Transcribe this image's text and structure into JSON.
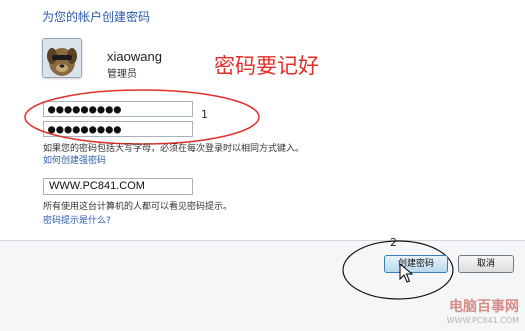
{
  "dialog": {
    "title": "为您的帐户创建密码"
  },
  "user": {
    "name": "xiaowang",
    "role": "管理员",
    "avatar_icon": "dog-avatar-icon"
  },
  "annotation": {
    "note": "密码要记好",
    "marker_1": "1",
    "marker_2": "2",
    "color": "#e0302a"
  },
  "form": {
    "password_value": "●●●●●●●●●",
    "confirm_value": "●●●●●●●●●",
    "case_warning": "如果您的密码包括大写字母，必须在每次登录时以相同方式键入。",
    "strong_password_link": "如何创建强密码",
    "hint_value": "WWW.PC841.COM",
    "hint_note": "所有使用这台计算机的人都可以看见密码提示。",
    "hint_link": "密码提示是什么?"
  },
  "buttons": {
    "create": "创建密码",
    "cancel": "取消"
  },
  "watermark": {
    "brand": "电脑百事网",
    "url": "WWW.PC841.COM"
  }
}
